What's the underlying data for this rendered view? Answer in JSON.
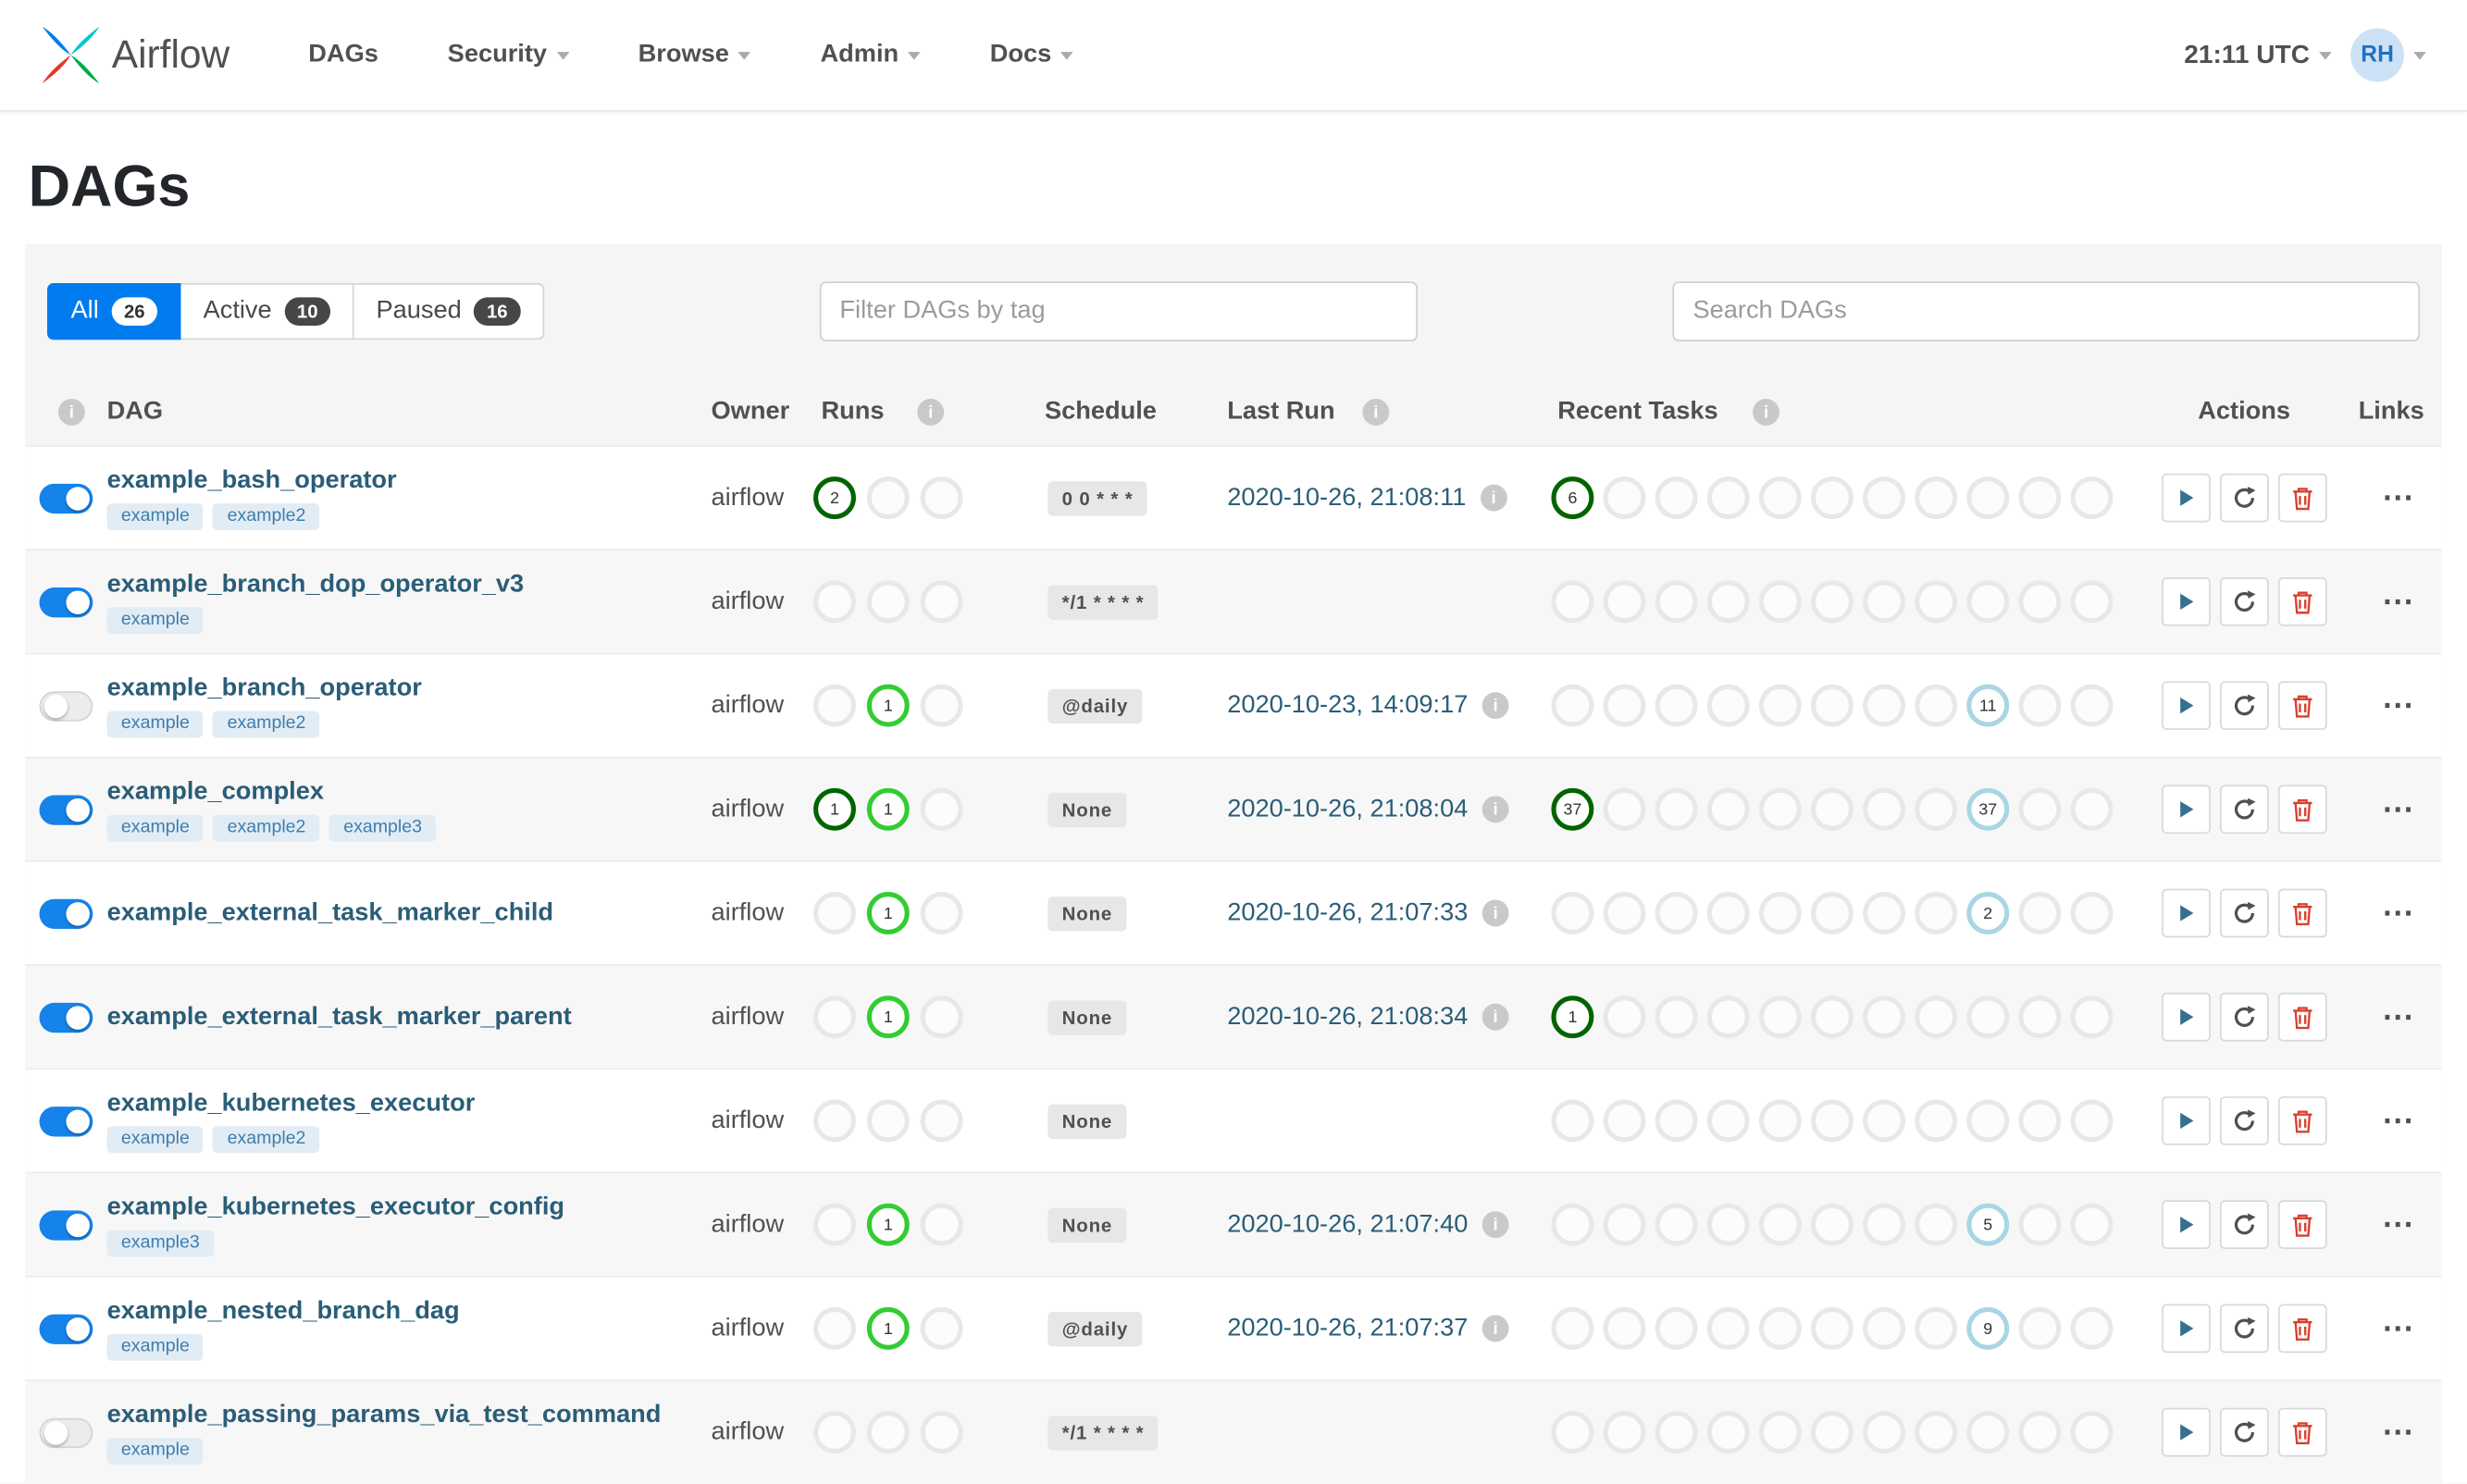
{
  "navbar": {
    "brand": "Airflow",
    "items": [
      {
        "label": "DAGs",
        "dropdown": false
      },
      {
        "label": "Security",
        "dropdown": true
      },
      {
        "label": "Browse",
        "dropdown": true
      },
      {
        "label": "Admin",
        "dropdown": true
      },
      {
        "label": "Docs",
        "dropdown": true
      }
    ],
    "clock": "21:11 UTC",
    "avatar": "RH"
  },
  "page": {
    "title": "DAGs"
  },
  "filters": {
    "tabs": [
      {
        "label": "All",
        "count": "26",
        "active": true
      },
      {
        "label": "Active",
        "count": "10",
        "active": false
      },
      {
        "label": "Paused",
        "count": "16",
        "active": false
      }
    ],
    "tag_filter_placeholder": "Filter DAGs by tag",
    "search_placeholder": "Search DAGs"
  },
  "colors": {
    "primary": "#017cee",
    "link": "#2a5d78",
    "success": "#006400",
    "running": "#32cd32",
    "none": "#a8d6e5",
    "danger": "#d9402e",
    "toggle_on": "#1583e9"
  },
  "table": {
    "columns": [
      "DAG",
      "Owner",
      "Runs",
      "Schedule",
      "Last Run",
      "Recent Tasks",
      "Actions",
      "Links"
    ],
    "runs_slots": 3,
    "task_slots": 11,
    "links_label": "⋯",
    "rows": [
      {
        "name": "example_bash_operator",
        "enabled": true,
        "tags": [
          "example",
          "example2"
        ],
        "owner": "airflow",
        "runs": [
          {
            "slot": 0,
            "count": "2",
            "state": "success"
          }
        ],
        "schedule": "0 0 * * *",
        "last_run": "2020-10-26, 21:08:11",
        "tasks": [
          {
            "slot": 0,
            "count": "6",
            "state": "success"
          }
        ]
      },
      {
        "name": "example_branch_dop_operator_v3",
        "enabled": true,
        "tags": [
          "example"
        ],
        "owner": "airflow",
        "runs": [],
        "schedule": "*/1 * * * *",
        "last_run": "",
        "tasks": []
      },
      {
        "name": "example_branch_operator",
        "enabled": false,
        "tags": [
          "example",
          "example2"
        ],
        "owner": "airflow",
        "runs": [
          {
            "slot": 1,
            "count": "1",
            "state": "running"
          }
        ],
        "schedule": "@daily",
        "last_run": "2020-10-23, 14:09:17",
        "tasks": [
          {
            "slot": 8,
            "count": "11",
            "state": "none"
          }
        ]
      },
      {
        "name": "example_complex",
        "enabled": true,
        "tags": [
          "example",
          "example2",
          "example3"
        ],
        "owner": "airflow",
        "runs": [
          {
            "slot": 0,
            "count": "1",
            "state": "success"
          },
          {
            "slot": 1,
            "count": "1",
            "state": "running"
          }
        ],
        "schedule": "None",
        "last_run": "2020-10-26, 21:08:04",
        "tasks": [
          {
            "slot": 0,
            "count": "37",
            "state": "success"
          },
          {
            "slot": 8,
            "count": "37",
            "state": "none"
          }
        ]
      },
      {
        "name": "example_external_task_marker_child",
        "enabled": true,
        "tags": [],
        "owner": "airflow",
        "runs": [
          {
            "slot": 1,
            "count": "1",
            "state": "running"
          }
        ],
        "schedule": "None",
        "last_run": "2020-10-26, 21:07:33",
        "tasks": [
          {
            "slot": 8,
            "count": "2",
            "state": "none"
          }
        ]
      },
      {
        "name": "example_external_task_marker_parent",
        "enabled": true,
        "tags": [],
        "owner": "airflow",
        "runs": [
          {
            "slot": 1,
            "count": "1",
            "state": "running"
          }
        ],
        "schedule": "None",
        "last_run": "2020-10-26, 21:08:34",
        "tasks": [
          {
            "slot": 0,
            "count": "1",
            "state": "success"
          }
        ]
      },
      {
        "name": "example_kubernetes_executor",
        "enabled": true,
        "tags": [
          "example",
          "example2"
        ],
        "owner": "airflow",
        "runs": [],
        "schedule": "None",
        "last_run": "",
        "tasks": []
      },
      {
        "name": "example_kubernetes_executor_config",
        "enabled": true,
        "tags": [
          "example3"
        ],
        "owner": "airflow",
        "runs": [
          {
            "slot": 1,
            "count": "1",
            "state": "running"
          }
        ],
        "schedule": "None",
        "last_run": "2020-10-26, 21:07:40",
        "tasks": [
          {
            "slot": 8,
            "count": "5",
            "state": "none"
          }
        ]
      },
      {
        "name": "example_nested_branch_dag",
        "enabled": true,
        "tags": [
          "example"
        ],
        "owner": "airflow",
        "runs": [
          {
            "slot": 1,
            "count": "1",
            "state": "running"
          }
        ],
        "schedule": "@daily",
        "last_run": "2020-10-26, 21:07:37",
        "tasks": [
          {
            "slot": 8,
            "count": "9",
            "state": "none"
          }
        ]
      },
      {
        "name": "example_passing_params_via_test_command",
        "enabled": false,
        "tags": [
          "example"
        ],
        "owner": "airflow",
        "runs": [],
        "schedule": "*/1 * * * *",
        "last_run": "",
        "tasks": []
      }
    ]
  }
}
